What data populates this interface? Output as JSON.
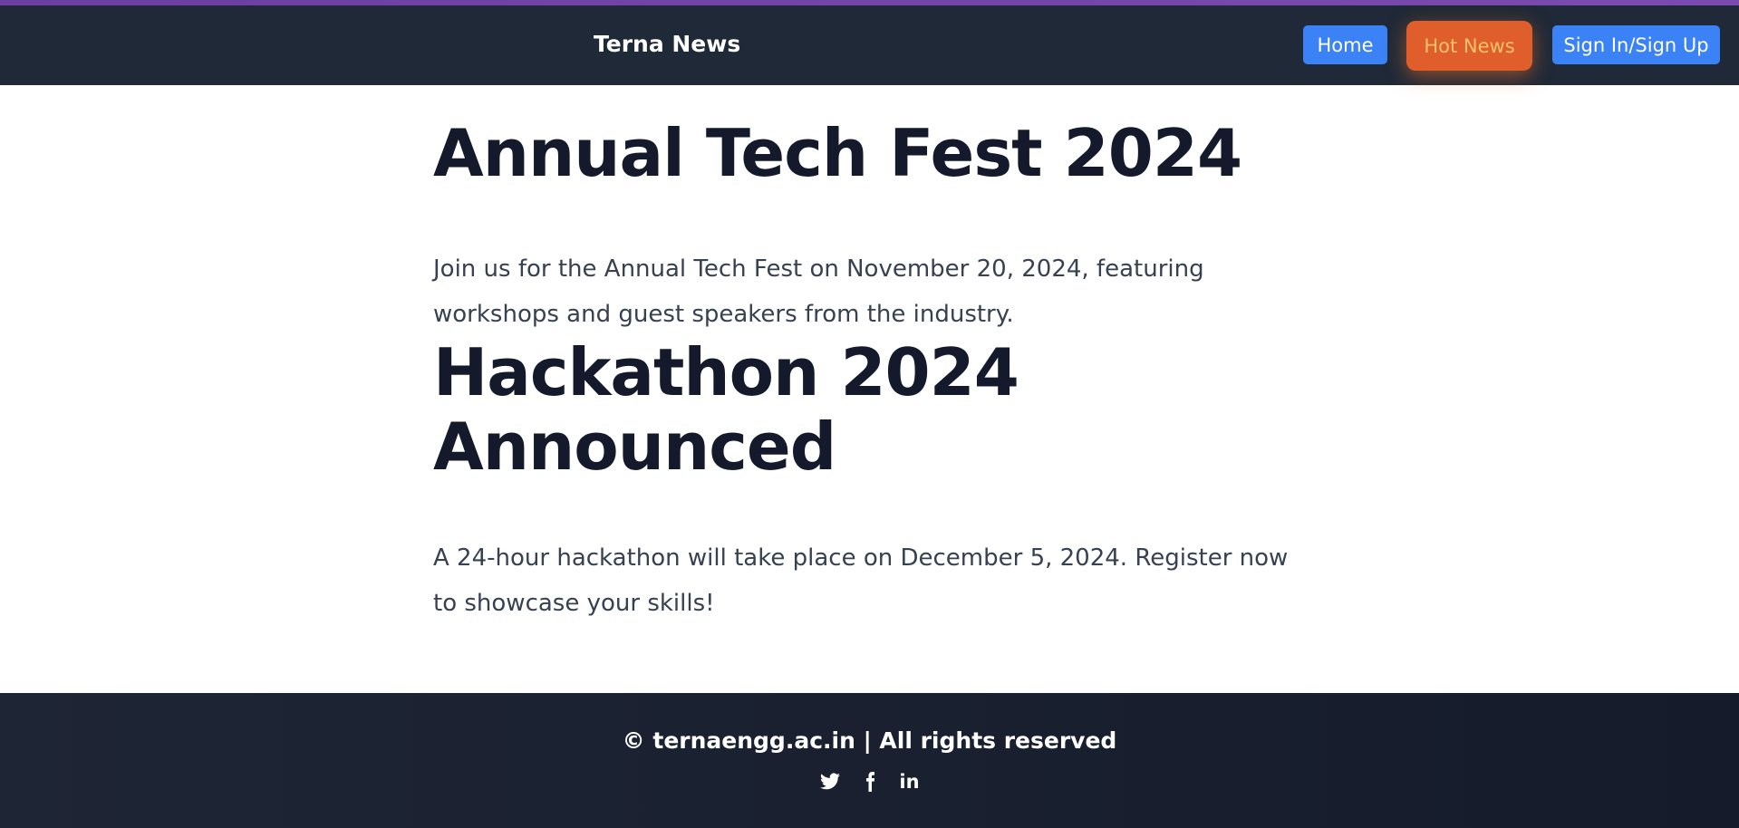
{
  "header": {
    "brand": "Terna News",
    "nav": {
      "home": "Home",
      "hot_news": "Hot News",
      "sign_in": "Sign In/Sign Up"
    }
  },
  "articles": [
    {
      "title": "Annual Tech Fest 2024",
      "body": "Join us for the Annual Tech Fest on November 20, 2024, featuring workshops and guest speakers from the industry."
    },
    {
      "title": "Hackathon 2024 Announced",
      "body": "A 24-hour hackathon will take place on December 5, 2024. Register now to showcase your skills!"
    }
  ],
  "footer": {
    "copyright": "© ternaengg.ac.in | All rights reserved",
    "social_icons": [
      "twitter-icon",
      "facebook-icon",
      "linkedin-icon"
    ],
    "linkedin_label": "in"
  },
  "colors": {
    "header_bg": "#1f2937",
    "nav_button": "#3b82f6",
    "hot_news_button": "#e05d2c",
    "accent_bar": "#6b3fa0"
  }
}
